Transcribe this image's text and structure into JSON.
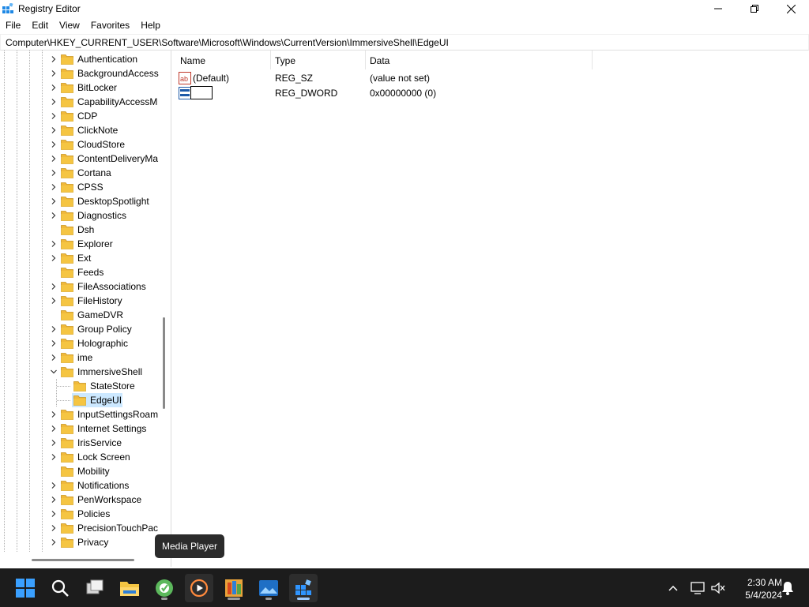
{
  "window": {
    "title": "Registry Editor"
  },
  "menu": [
    "File",
    "Edit",
    "View",
    "Favorites",
    "Help"
  ],
  "address": "Computer\\HKEY_CURRENT_USER\\Software\\Microsoft\\Windows\\CurrentVersion\\ImmersiveShell\\EdgeUI",
  "tree": {
    "items": [
      {
        "label": "Authentication",
        "level": 0,
        "expandable": true
      },
      {
        "label": "BackgroundAccess",
        "level": 0,
        "expandable": true
      },
      {
        "label": "BitLocker",
        "level": 0,
        "expandable": true
      },
      {
        "label": "CapabilityAccessM",
        "level": 0,
        "expandable": true
      },
      {
        "label": "CDP",
        "level": 0,
        "expandable": true
      },
      {
        "label": "ClickNote",
        "level": 0,
        "expandable": true
      },
      {
        "label": "CloudStore",
        "level": 0,
        "expandable": true
      },
      {
        "label": "ContentDeliveryMa",
        "level": 0,
        "expandable": true
      },
      {
        "label": "Cortana",
        "level": 0,
        "expandable": true
      },
      {
        "label": "CPSS",
        "level": 0,
        "expandable": true
      },
      {
        "label": "DesktopSpotlight",
        "level": 0,
        "expandable": true
      },
      {
        "label": "Diagnostics",
        "level": 0,
        "expandable": true
      },
      {
        "label": "Dsh",
        "level": 0,
        "expandable": false
      },
      {
        "label": "Explorer",
        "level": 0,
        "expandable": true
      },
      {
        "label": "Ext",
        "level": 0,
        "expandable": true
      },
      {
        "label": "Feeds",
        "level": 0,
        "expandable": false
      },
      {
        "label": "FileAssociations",
        "level": 0,
        "expandable": true
      },
      {
        "label": "FileHistory",
        "level": 0,
        "expandable": true
      },
      {
        "label": "GameDVR",
        "level": 0,
        "expandable": false
      },
      {
        "label": "Group Policy",
        "level": 0,
        "expandable": true
      },
      {
        "label": "Holographic",
        "level": 0,
        "expandable": true
      },
      {
        "label": "ime",
        "level": 0,
        "expandable": true
      },
      {
        "label": "ImmersiveShell",
        "level": 0,
        "expandable": true,
        "expanded": true
      },
      {
        "label": "StateStore",
        "level": 1,
        "expandable": false
      },
      {
        "label": "EdgeUI",
        "level": 1,
        "expandable": false,
        "selected": true
      },
      {
        "label": "InputSettingsRoam",
        "level": 0,
        "expandable": true
      },
      {
        "label": "Internet Settings",
        "level": 0,
        "expandable": true
      },
      {
        "label": "IrisService",
        "level": 0,
        "expandable": true
      },
      {
        "label": "Lock Screen",
        "level": 0,
        "expandable": true
      },
      {
        "label": "Mobility",
        "level": 0,
        "expandable": false
      },
      {
        "label": "Notifications",
        "level": 0,
        "expandable": true
      },
      {
        "label": "PenWorkspace",
        "level": 0,
        "expandable": true
      },
      {
        "label": "Policies",
        "level": 0,
        "expandable": true
      },
      {
        "label": "PrecisionTouchPac",
        "level": 0,
        "expandable": true
      },
      {
        "label": "Privacy",
        "level": 0,
        "expandable": true
      }
    ]
  },
  "list": {
    "headers": {
      "name": "Name",
      "type": "Type",
      "data": "Data"
    },
    "rows": [
      {
        "name": "(Default)",
        "type": "REG_SZ",
        "data": "(value not set)",
        "icon": "string-value-icon"
      },
      {
        "name": "",
        "type": "REG_DWORD",
        "data": "0x00000000 (0)",
        "icon": "dword-value-icon",
        "editing": true
      }
    ]
  },
  "tooltip": "Media Player",
  "taskbar": {
    "icons": [
      "windows-start-icon",
      "search-icon",
      "task-view-icon",
      "file-explorer-icon",
      "app-icon",
      "media-player-icon",
      "office-app-icon",
      "photos-app-icon",
      "registry-editor-icon"
    ],
    "time": "2:30 AM",
    "date": "5/4/2024"
  },
  "colors": {
    "selection": "#cce8ff",
    "taskbar": "#1c1c1c",
    "folder": "#f5c542"
  }
}
